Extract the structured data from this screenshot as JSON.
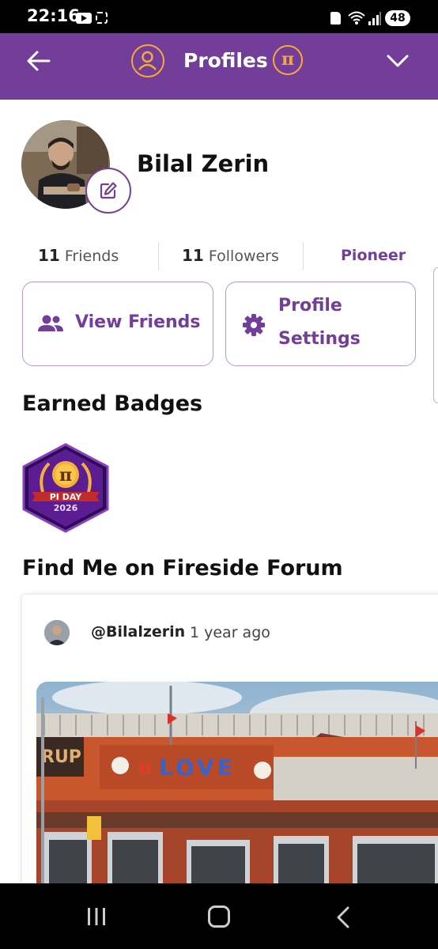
{
  "status_bar": {
    "time": "22:16",
    "battery": "48"
  },
  "header": {
    "title": "Profiles",
    "pi_symbol": "π"
  },
  "profile": {
    "name": "Bilal Zerin",
    "friends_count": "11",
    "friends_label": "Friends",
    "followers_count": "11",
    "followers_label": "Followers",
    "role": "Pioneer"
  },
  "actions": {
    "view_friends": "View Friends",
    "profile_settings_line1": "Profile",
    "profile_settings_line2": "Settings"
  },
  "badges": {
    "title": "Earned Badges",
    "items": [
      {
        "icon": "pi-day-2026-badge-icon",
        "label": "PI DAY",
        "year": "2026",
        "pi_symbol": "π"
      }
    ]
  },
  "forum": {
    "title": "Find Me on Fireside Forum",
    "post": {
      "username": "@Bilalzerin",
      "time": "1 year ago",
      "sign_text": "LOVE",
      "sign_left": "RUP",
      "sign_pi": "π"
    }
  },
  "colors": {
    "brand_purple": "#733d9a",
    "accent_orange": "#f7a935"
  }
}
